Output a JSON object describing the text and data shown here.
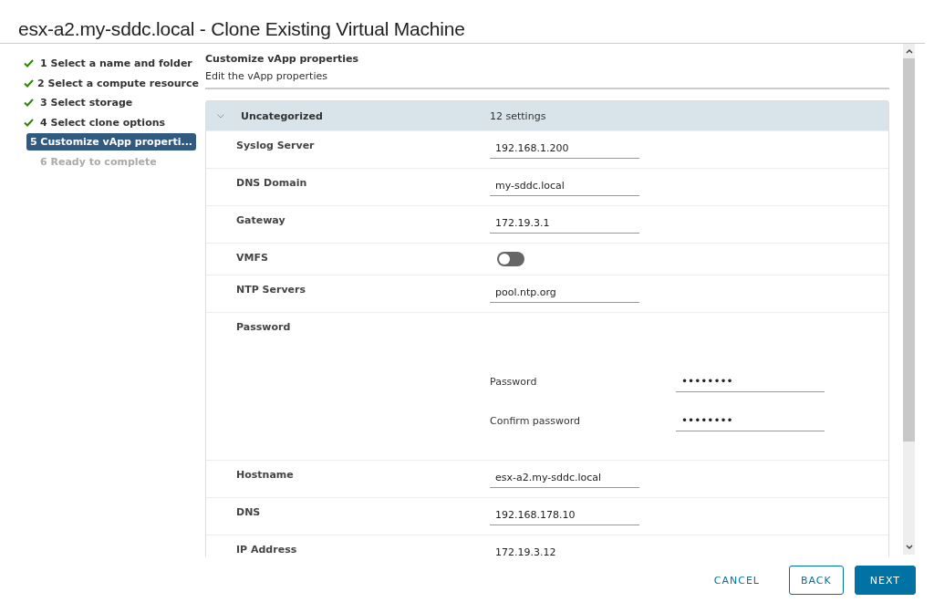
{
  "window": {
    "title": "esx-a2.my-sddc.local - Clone Existing Virtual Machine"
  },
  "steps": [
    {
      "label": "1 Select a name and folder",
      "completed": true,
      "selected": false
    },
    {
      "label": "2 Select a compute resource",
      "completed": true,
      "selected": false
    },
    {
      "label": "3 Select storage",
      "completed": true,
      "selected": false
    },
    {
      "label": "4 Select clone options",
      "completed": true,
      "selected": false
    },
    {
      "label": "5 Customize vApp properti...",
      "completed": false,
      "selected": true
    },
    {
      "label": "6 Ready to complete",
      "completed": false,
      "selected": false
    }
  ],
  "page": {
    "title": "Customize vApp properties",
    "subtitle": "Edit the vApp properties"
  },
  "group": {
    "name": "Uncategorized",
    "count": "12 settings",
    "expanded": true
  },
  "properties": [
    {
      "kind": "text",
      "label": "Syslog Server",
      "value": "192.168.1.200"
    },
    {
      "kind": "text",
      "label": "DNS Domain",
      "value": "my-sddc.local"
    },
    {
      "kind": "text",
      "label": "Gateway",
      "value": "172.19.3.1"
    },
    {
      "kind": "toggle",
      "label": "VMFS",
      "on": false
    },
    {
      "kind": "text",
      "label": "NTP Servers",
      "value": "pool.ntp.org"
    },
    {
      "kind": "password",
      "label": "Password",
      "fields": [
        {
          "label": "Password",
          "value": "••••••••"
        },
        {
          "label": "Confirm password",
          "value": "••••••••"
        }
      ]
    },
    {
      "kind": "text",
      "label": "Hostname",
      "value": "esx-a2.my-sddc.local"
    },
    {
      "kind": "text",
      "label": "DNS",
      "value": "192.168.178.10"
    },
    {
      "kind": "text",
      "label": "IP Address",
      "value": "172.19.3.12"
    }
  ],
  "buttons": [
    {
      "label": "CANCEL",
      "kind": "flat"
    },
    {
      "label": "BACK",
      "kind": "outline"
    },
    {
      "label": "NEXT",
      "kind": "primary"
    }
  ]
}
